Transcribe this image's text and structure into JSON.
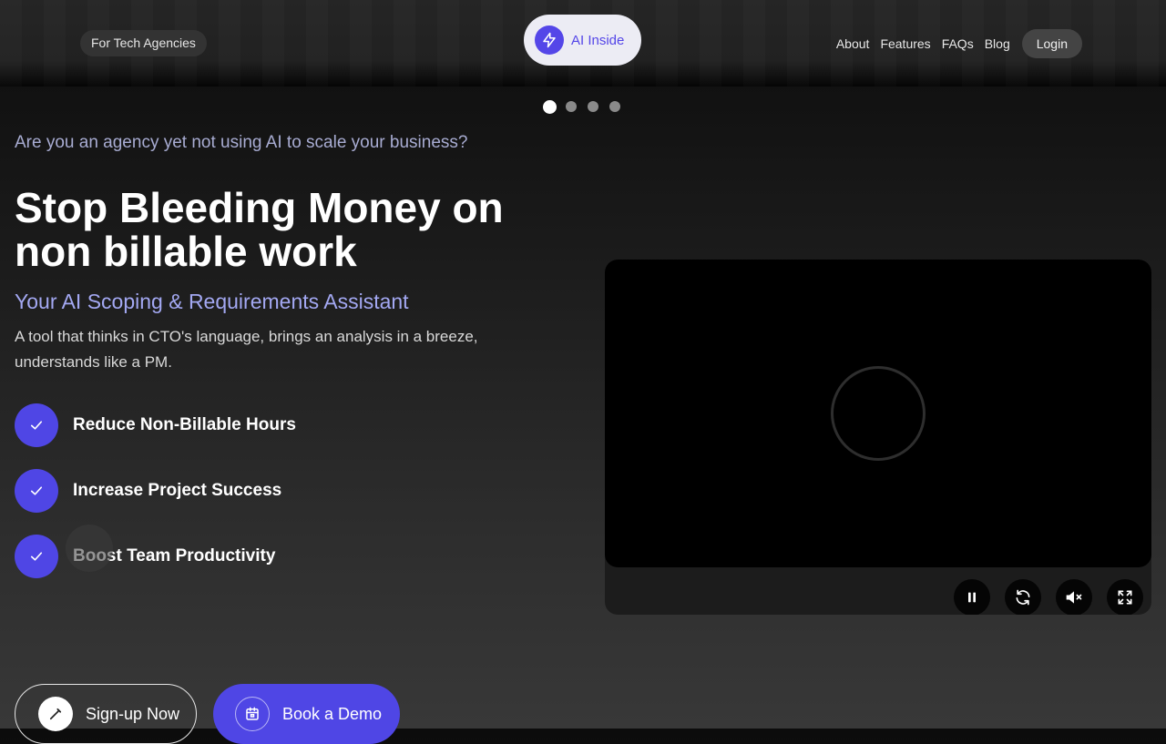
{
  "header": {
    "audience_chip": "For Tech Agencies",
    "badge_label": "AI Inside",
    "badge_icon": "lightning-bolt-icon",
    "nav": [
      "About",
      "Features",
      "FAQs",
      "Blog"
    ],
    "login_label": "Login"
  },
  "carousel": {
    "slide_count": 4,
    "active_index": 0
  },
  "hero": {
    "eyebrow": "Are you an agency yet not using AI to scale your business?",
    "headline_line1": "Stop Bleeding Money on",
    "headline_line2": "non billable work",
    "subheadline": "Your AI Scoping & Requirements Assistant",
    "description": "A tool that thinks in CTO's language, brings an analysis in a breeze, understands like a PM.",
    "benefits": [
      "Reduce Non-Billable Hours",
      "Increase Project Success",
      "Boost Team Productivity"
    ]
  },
  "cta": {
    "signup_label": "Sign-up Now",
    "demo_label": "Book a Demo"
  },
  "video": {
    "state": "loading",
    "controls": [
      "pause-icon",
      "replay-icon",
      "mute-icon",
      "fullscreen-icon"
    ]
  },
  "colors": {
    "accent": "#4f46e5",
    "subhead": "#a3a8f2",
    "eyebrow": "#a8acd2"
  }
}
